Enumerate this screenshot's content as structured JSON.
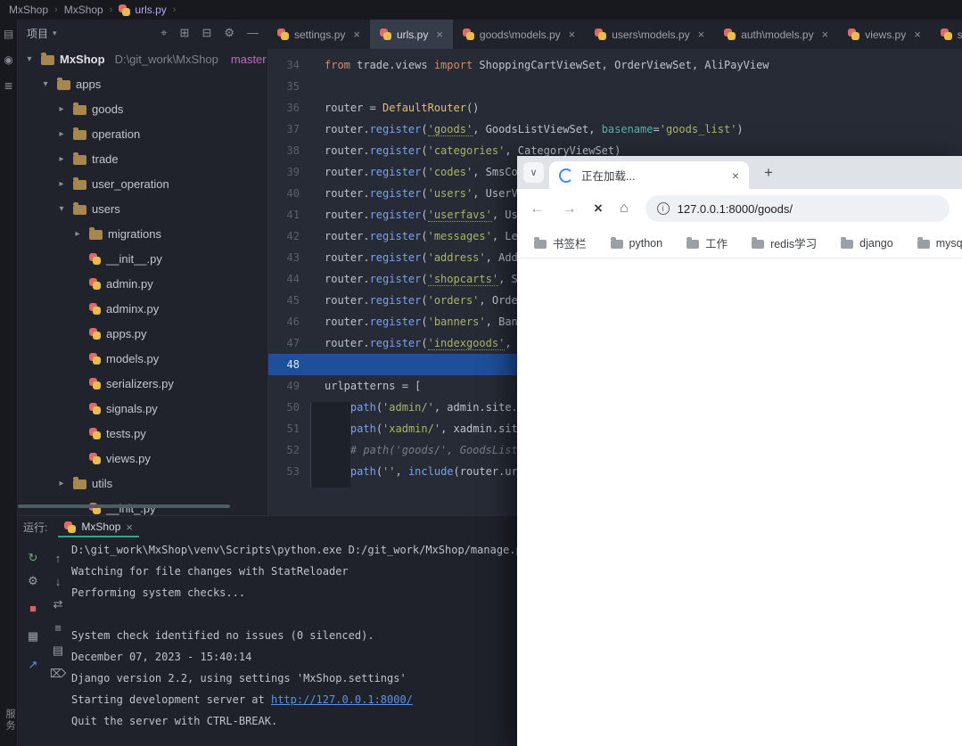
{
  "icons": {
    "close": "×",
    "plus": "+",
    "info": "i",
    "breadcrumb_separator": "›",
    "chevron_expanded": "▾",
    "chevron_collapsed": "▸",
    "tab_dropdown": "∨",
    "back": "←",
    "forward": "→",
    "stop": "×",
    "home": "⌂",
    "dropdown_caret": "▾"
  },
  "breadcrumb": {
    "items": [
      "MxShop",
      "MxShop",
      "urls.py"
    ]
  },
  "toolstrip": {
    "top_icons": [
      {
        "name": "project-icon",
        "glyph": "▤"
      },
      {
        "name": "commit-icon",
        "glyph": "◉"
      },
      {
        "name": "structure-icon",
        "glyph": "≣"
      }
    ],
    "bottom_label": "服务"
  },
  "project_panel": {
    "title": "项目",
    "header_icons": [
      {
        "name": "locate-file-button",
        "glyph": "⌖"
      },
      {
        "name": "expand-all-button",
        "glyph": "⊞"
      },
      {
        "name": "collapse-all-button",
        "glyph": "⊟"
      },
      {
        "name": "settings-gear-icon",
        "glyph": "⚙"
      },
      {
        "name": "hide-panel-button",
        "glyph": "—"
      }
    ],
    "root": {
      "name": "MxShop",
      "path": "D:\\git_work\\MxShop",
      "branch": "master"
    },
    "tree": [
      {
        "label": "apps",
        "type": "folder",
        "indent": 1,
        "expanded": true
      },
      {
        "label": "goods",
        "type": "folder",
        "indent": 2,
        "expanded": false
      },
      {
        "label": "operation",
        "type": "folder",
        "indent": 2,
        "expanded": false
      },
      {
        "label": "trade",
        "type": "folder",
        "indent": 2,
        "expanded": false
      },
      {
        "label": "user_operation",
        "type": "folder",
        "indent": 2,
        "expanded": false
      },
      {
        "label": "users",
        "type": "folder",
        "indent": 2,
        "expanded": true
      },
      {
        "label": "migrations",
        "type": "folder",
        "indent": 3,
        "expanded": false
      },
      {
        "label": "__init__.py",
        "type": "pyfile",
        "indent": 3
      },
      {
        "label": "admin.py",
        "type": "pyfile",
        "indent": 3
      },
      {
        "label": "adminx.py",
        "type": "pyfile",
        "indent": 3
      },
      {
        "label": "apps.py",
        "type": "pyfile",
        "indent": 3
      },
      {
        "label": "models.py",
        "type": "pyfile",
        "indent": 3
      },
      {
        "label": "serializers.py",
        "type": "pyfile",
        "indent": 3
      },
      {
        "label": "signals.py",
        "type": "pyfile",
        "indent": 3
      },
      {
        "label": "tests.py",
        "type": "pyfile",
        "indent": 3
      },
      {
        "label": "views.py",
        "type": "pyfile",
        "indent": 3
      },
      {
        "label": "utils",
        "type": "folder",
        "indent": 2,
        "expanded": false
      },
      {
        "label": "__init_.py",
        "type": "pyfile",
        "indent": 3
      }
    ]
  },
  "editor_tabs": [
    {
      "label": "settings.py"
    },
    {
      "label": "urls.py",
      "active": true
    },
    {
      "label": "goods\\models.py"
    },
    {
      "label": "users\\models.py"
    },
    {
      "label": "auth\\models.py"
    },
    {
      "label": "views.py"
    },
    {
      "label": "ser"
    }
  ],
  "editor": {
    "lines": [
      {
        "num": 34,
        "segs": [
          [
            "kw",
            "from"
          ],
          [
            "pl",
            " trade.views "
          ],
          [
            "kw",
            "import"
          ],
          [
            "pl",
            " ShoppingCartViewSet, OrderViewSet, AliPayView"
          ]
        ]
      },
      {
        "num": 35,
        "segs": []
      },
      {
        "num": 36,
        "segs": [
          [
            "pl",
            "router = "
          ],
          [
            "cls",
            "DefaultRouter"
          ],
          [
            "pl",
            "()"
          ]
        ]
      },
      {
        "num": 37,
        "segs": [
          [
            "pl",
            "router."
          ],
          [
            "fn",
            "register"
          ],
          [
            "pl",
            "("
          ],
          [
            "strU",
            "'goods'"
          ],
          [
            "pl",
            ", GoodsListViewSet, "
          ],
          [
            "param",
            "basename"
          ],
          [
            "pl",
            "="
          ],
          [
            "str",
            "'goods_list'"
          ],
          [
            "pl",
            ")"
          ]
        ]
      },
      {
        "num": 38,
        "segs": [
          [
            "pl",
            "router."
          ],
          [
            "fn",
            "register"
          ],
          [
            "pl",
            "("
          ],
          [
            "str",
            "'categories'"
          ],
          [
            "pl",
            ", CategoryViewSet)"
          ]
        ]
      },
      {
        "num": 39,
        "segs": [
          [
            "pl",
            "router."
          ],
          [
            "fn",
            "register"
          ],
          [
            "pl",
            "("
          ],
          [
            "str",
            "'codes'"
          ],
          [
            "pl",
            ", SmsCodeViews"
          ]
        ]
      },
      {
        "num": 40,
        "segs": [
          [
            "pl",
            "router."
          ],
          [
            "fn",
            "register"
          ],
          [
            "pl",
            "("
          ],
          [
            "str",
            "'users'"
          ],
          [
            "pl",
            ", UserViewset,"
          ]
        ]
      },
      {
        "num": 41,
        "segs": [
          [
            "pl",
            "router."
          ],
          [
            "fn",
            "register"
          ],
          [
            "pl",
            "("
          ],
          [
            "strU",
            "'userfavs'"
          ],
          [
            "pl",
            ", UserFavV"
          ]
        ]
      },
      {
        "num": 42,
        "segs": [
          [
            "pl",
            "router."
          ],
          [
            "fn",
            "register"
          ],
          [
            "pl",
            "("
          ],
          [
            "str",
            "'messages'"
          ],
          [
            "pl",
            ", LeavingM"
          ]
        ]
      },
      {
        "num": 43,
        "segs": [
          [
            "pl",
            "router."
          ],
          [
            "fn",
            "register"
          ],
          [
            "pl",
            "("
          ],
          [
            "str",
            "'address'"
          ],
          [
            "pl",
            ", AddressVi"
          ]
        ]
      },
      {
        "num": 44,
        "segs": [
          [
            "pl",
            "router."
          ],
          [
            "fn",
            "register"
          ],
          [
            "pl",
            "("
          ],
          [
            "strU",
            "'shopcarts'"
          ],
          [
            "pl",
            ", Shoppin"
          ]
        ]
      },
      {
        "num": 45,
        "segs": [
          [
            "pl",
            "router."
          ],
          [
            "fn",
            "register"
          ],
          [
            "pl",
            "("
          ],
          [
            "str",
            "'orders'"
          ],
          [
            "pl",
            ", OrderView"
          ]
        ]
      },
      {
        "num": 46,
        "segs": [
          [
            "pl",
            "router."
          ],
          [
            "fn",
            "register"
          ],
          [
            "pl",
            "("
          ],
          [
            "str",
            "'banners'"
          ],
          [
            "pl",
            ", BannerVi"
          ]
        ]
      },
      {
        "num": 47,
        "segs": [
          [
            "pl",
            "router."
          ],
          [
            "fn",
            "register"
          ],
          [
            "pl",
            "("
          ],
          [
            "strU",
            "'indexgoods'"
          ],
          [
            "pl",
            ", Index"
          ]
        ]
      },
      {
        "num": 48,
        "segs": [],
        "highlight": true
      },
      {
        "num": 49,
        "segs": [
          [
            "pl",
            "urlpatterns = ["
          ]
        ]
      },
      {
        "num": 50,
        "segs": [
          [
            "pl",
            "    "
          ],
          [
            "fn",
            "path"
          ],
          [
            "pl",
            "("
          ],
          [
            "str",
            "'admin/'"
          ],
          [
            "pl",
            ", admin.site.url"
          ]
        ]
      },
      {
        "num": 51,
        "segs": [
          [
            "pl",
            "    "
          ],
          [
            "fn",
            "path"
          ],
          [
            "pl",
            "("
          ],
          [
            "str",
            "'xadmin/'"
          ],
          [
            "pl",
            ", xadmin.site"
          ]
        ]
      },
      {
        "num": 52,
        "segs": [
          [
            "cm",
            "    # path('goods/', GoodsListVie"
          ]
        ]
      },
      {
        "num": 53,
        "segs": [
          [
            "pl",
            "    "
          ],
          [
            "fn",
            "path"
          ],
          [
            "pl",
            "("
          ],
          [
            "str",
            "''"
          ],
          [
            "pl",
            ", "
          ],
          [
            "fn",
            "include"
          ],
          [
            "pl",
            "(router.urls)"
          ]
        ]
      }
    ]
  },
  "run_panel": {
    "label": "运行:",
    "tab": "MxShop",
    "toolbar_col1": [
      {
        "name": "rerun-button",
        "glyph": "↻",
        "color": "#6cae73"
      },
      {
        "name": "edit-configuration-button",
        "glyph": "⚙",
        "color": "#9aa0a8"
      },
      {
        "name": "stop-button",
        "glyph": "■",
        "color": "#d4645f"
      },
      {
        "name": "pin-tab-button",
        "glyph": "▦",
        "color": "#9aa0a8"
      },
      {
        "name": "scroll-to-end-button",
        "glyph": "↗",
        "color": "#5b92e8"
      }
    ],
    "toolbar_col2": [
      {
        "name": "up-stack-button",
        "glyph": "↑",
        "color": "#9aa0a8"
      },
      {
        "name": "down-stack-button",
        "glyph": "↓",
        "color": "#9aa0a8"
      },
      {
        "name": "restart-server-button",
        "glyph": "⇄",
        "color": "#9aa0a8"
      },
      {
        "name": "soft-wrap-button",
        "glyph": "≡",
        "color": "#9aa0a8"
      },
      {
        "name": "print-console-button",
        "glyph": "▤",
        "color": "#9aa0a8"
      },
      {
        "name": "clear-console-button",
        "glyph": "⌦",
        "color": "#9aa0a8"
      }
    ],
    "console": [
      {
        "text": "D:\\git_work\\MxShop\\venv\\Scripts\\python.exe D:/git_work/MxShop/manage.py"
      },
      {
        "text": "Watching for file changes with StatReloader"
      },
      {
        "text": "Performing system checks..."
      },
      {
        "text": ""
      },
      {
        "text": "System check identified no issues (0 silenced)."
      },
      {
        "text": "December 07, 2023 - 15:40:14"
      },
      {
        "text": "Django version 2.2, using settings 'MxShop.settings'"
      },
      {
        "text": "Starting development server at ",
        "link": "http://127.0.0.1:8000/"
      },
      {
        "text": "Quit the server with CTRL-BREAK."
      }
    ]
  },
  "browser": {
    "tab_title": "正在加载...",
    "url": "127.0.0.1:8000/goods/",
    "bookmarks": [
      "书签栏",
      "python",
      "工作",
      "redis学习",
      "django",
      "mysql"
    ]
  }
}
